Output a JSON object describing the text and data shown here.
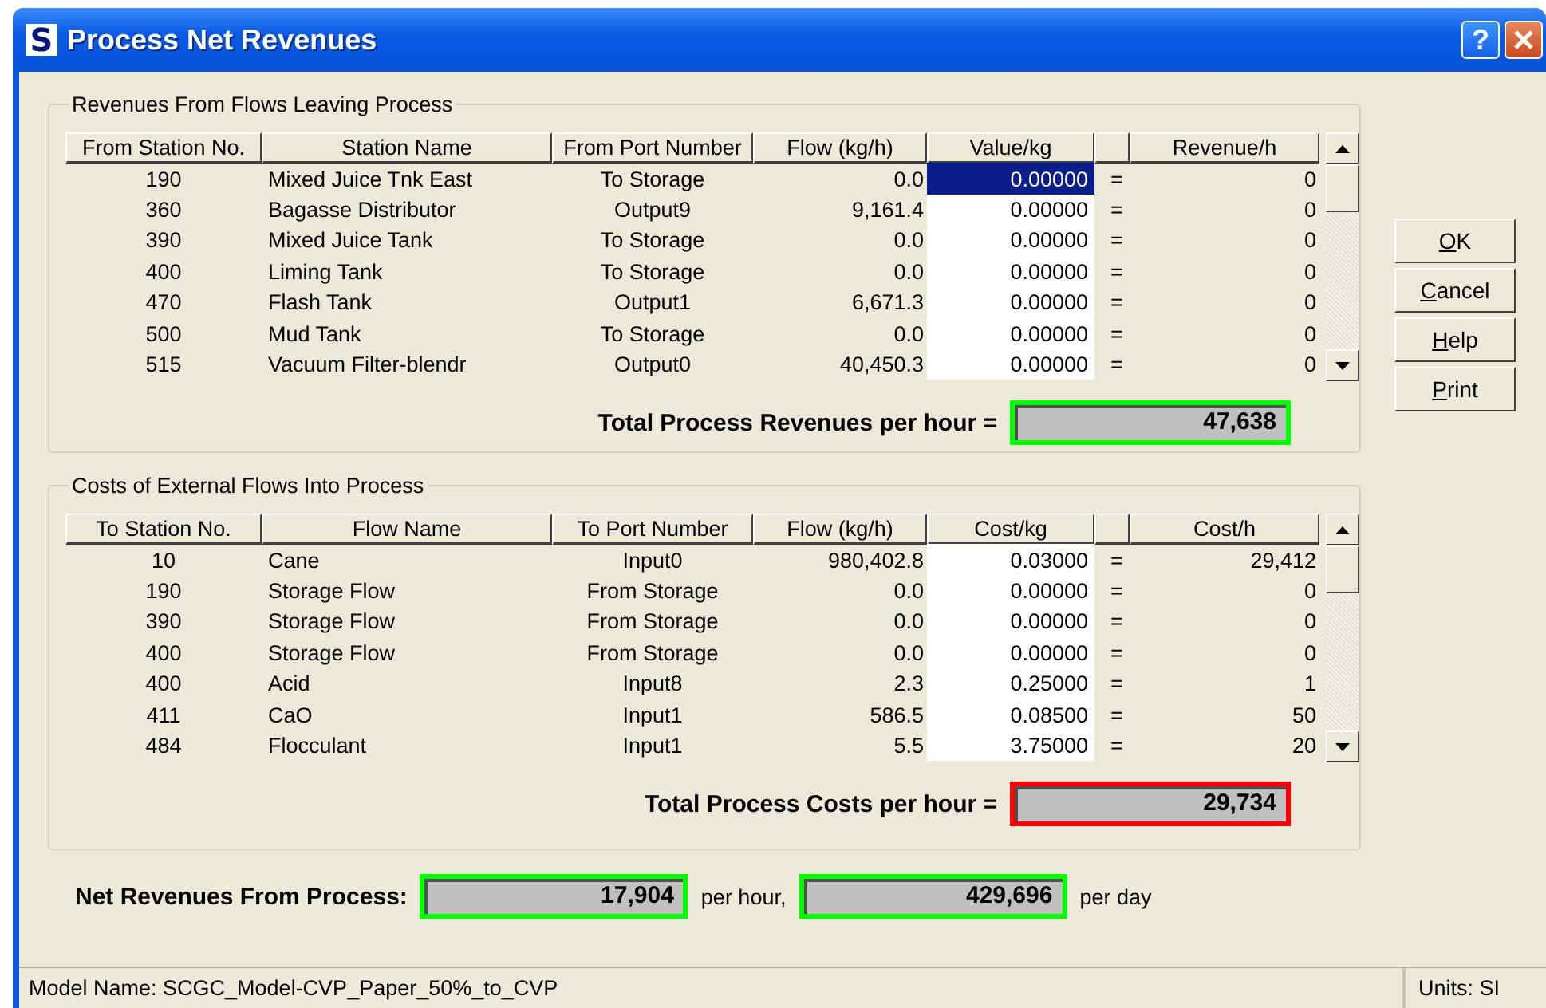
{
  "window": {
    "title": "Process Net Revenues",
    "app_icon": "S",
    "help_glyph": "?"
  },
  "revenues": {
    "title": "Revenues From Flows Leaving Process",
    "columns": [
      "From Station No.",
      "Station Name",
      "From Port Number",
      "Flow (kg/h)",
      "Value/kg",
      "Revenue/h"
    ],
    "rows": [
      {
        "station": "190",
        "name": "Mixed Juice Tnk East",
        "port": "To Storage",
        "flow": "0.0",
        "price": "0.00000",
        "eq": "=",
        "amount": "0",
        "selected": true
      },
      {
        "station": "360",
        "name": "Bagasse Distributor",
        "port": "Output9",
        "flow": "9,161.4",
        "price": "0.00000",
        "eq": "=",
        "amount": "0",
        "selected": false
      },
      {
        "station": "390",
        "name": "Mixed Juice Tank",
        "port": "To Storage",
        "flow": "0.0",
        "price": "0.00000",
        "eq": "=",
        "amount": "0",
        "selected": false
      },
      {
        "station": "400",
        "name": "Liming Tank",
        "port": "To Storage",
        "flow": "0.0",
        "price": "0.00000",
        "eq": "=",
        "amount": "0",
        "selected": false
      },
      {
        "station": "470",
        "name": "Flash Tank",
        "port": "Output1",
        "flow": "6,671.3",
        "price": "0.00000",
        "eq": "=",
        "amount": "0",
        "selected": false
      },
      {
        "station": "500",
        "name": "Mud Tank",
        "port": "To Storage",
        "flow": "0.0",
        "price": "0.00000",
        "eq": "=",
        "amount": "0",
        "selected": false
      },
      {
        "station": "515",
        "name": "Vacuum Filter-blendr",
        "port": "Output0",
        "flow": "40,450.3",
        "price": "0.00000",
        "eq": "=",
        "amount": "0",
        "selected": false
      }
    ],
    "total_label": "Total Process Revenues per hour =",
    "total": "47,638",
    "color": "#00ff00"
  },
  "costs": {
    "title": "Costs of External Flows Into Process",
    "columns": [
      "To Station No.",
      "Flow Name",
      "To Port Number",
      "Flow (kg/h)",
      "Cost/kg",
      "Cost/h"
    ],
    "rows": [
      {
        "station": "10",
        "name": "Cane",
        "port": "Input0",
        "flow": "980,402.8",
        "price": "0.03000",
        "eq": "=",
        "amount": "29,412",
        "selected": false
      },
      {
        "station": "190",
        "name": "Storage Flow",
        "port": "From Storage",
        "flow": "0.0",
        "price": "0.00000",
        "eq": "=",
        "amount": "0",
        "selected": false
      },
      {
        "station": "390",
        "name": "Storage Flow",
        "port": "From Storage",
        "flow": "0.0",
        "price": "0.00000",
        "eq": "=",
        "amount": "0",
        "selected": false
      },
      {
        "station": "400",
        "name": "Storage Flow",
        "port": "From Storage",
        "flow": "0.0",
        "price": "0.00000",
        "eq": "=",
        "amount": "0",
        "selected": false
      },
      {
        "station": "400",
        "name": "Acid",
        "port": "Input8",
        "flow": "2.3",
        "price": "0.25000",
        "eq": "=",
        "amount": "1",
        "selected": false
      },
      {
        "station": "411",
        "name": "CaO",
        "port": "Input1",
        "flow": "586.5",
        "price": "0.08500",
        "eq": "=",
        "amount": "50",
        "selected": false
      },
      {
        "station": "484",
        "name": "Flocculant",
        "port": "Input1",
        "flow": "5.5",
        "price": "3.75000",
        "eq": "=",
        "amount": "20",
        "selected": false
      }
    ],
    "total_label": "Total Process Costs per hour =",
    "total": "29,734",
    "color": "#ff0000"
  },
  "net": {
    "label": "Net Revenues From Process:",
    "per_hour": "17,904",
    "per_hour_unit": "per hour,",
    "per_day": "429,696",
    "per_day_unit": "per day",
    "color": "#00ff00"
  },
  "buttons": [
    "OK",
    "Cancel",
    "Help",
    "Print"
  ],
  "status_bar": {
    "model": "Model Name: SCGC_Model-CVP_Paper_50%_to_CVP",
    "units": "Units: SI"
  }
}
